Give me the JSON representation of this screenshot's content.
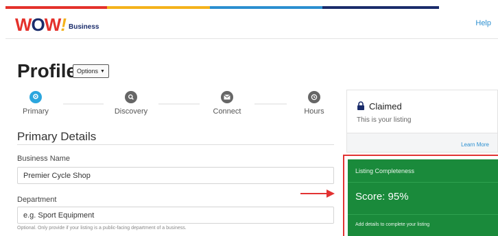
{
  "header": {
    "logo": {
      "mark": "WOW!",
      "product": "Business"
    },
    "help_label": "Help",
    "stripe_colors": [
      "#e4312b",
      "#f4b21b",
      "#2b8fd0",
      "#1a2c6b"
    ]
  },
  "profile": {
    "title": "Profile",
    "options_label": "Options"
  },
  "tabs": [
    {
      "label": "Primary",
      "icon": "location-pin-icon",
      "active": true,
      "color": "#2ba6de"
    },
    {
      "label": "Discovery",
      "icon": "search-icon",
      "active": false,
      "color": "#666666"
    },
    {
      "label": "Connect",
      "icon": "mail-icon",
      "active": false,
      "color": "#666666"
    },
    {
      "label": "Hours",
      "icon": "clock-icon",
      "active": false,
      "color": "#666666"
    }
  ],
  "section": {
    "title": "Primary Details"
  },
  "fields": {
    "business_name": {
      "label": "Business Name",
      "value": "Premier Cycle Shop"
    },
    "department": {
      "label": "Department",
      "placeholder": "e.g. Sport Equipment",
      "hint": "Optional. Only provide if your listing is a public-facing department of a business."
    }
  },
  "claimed": {
    "title": "Claimed",
    "subtitle": "This is your listing",
    "learn_more": "Learn More"
  },
  "completeness": {
    "title": "Listing Completeness",
    "score": "Score: 95%",
    "footer": "Add details to complete your listing",
    "color": "#1a8a3b"
  }
}
